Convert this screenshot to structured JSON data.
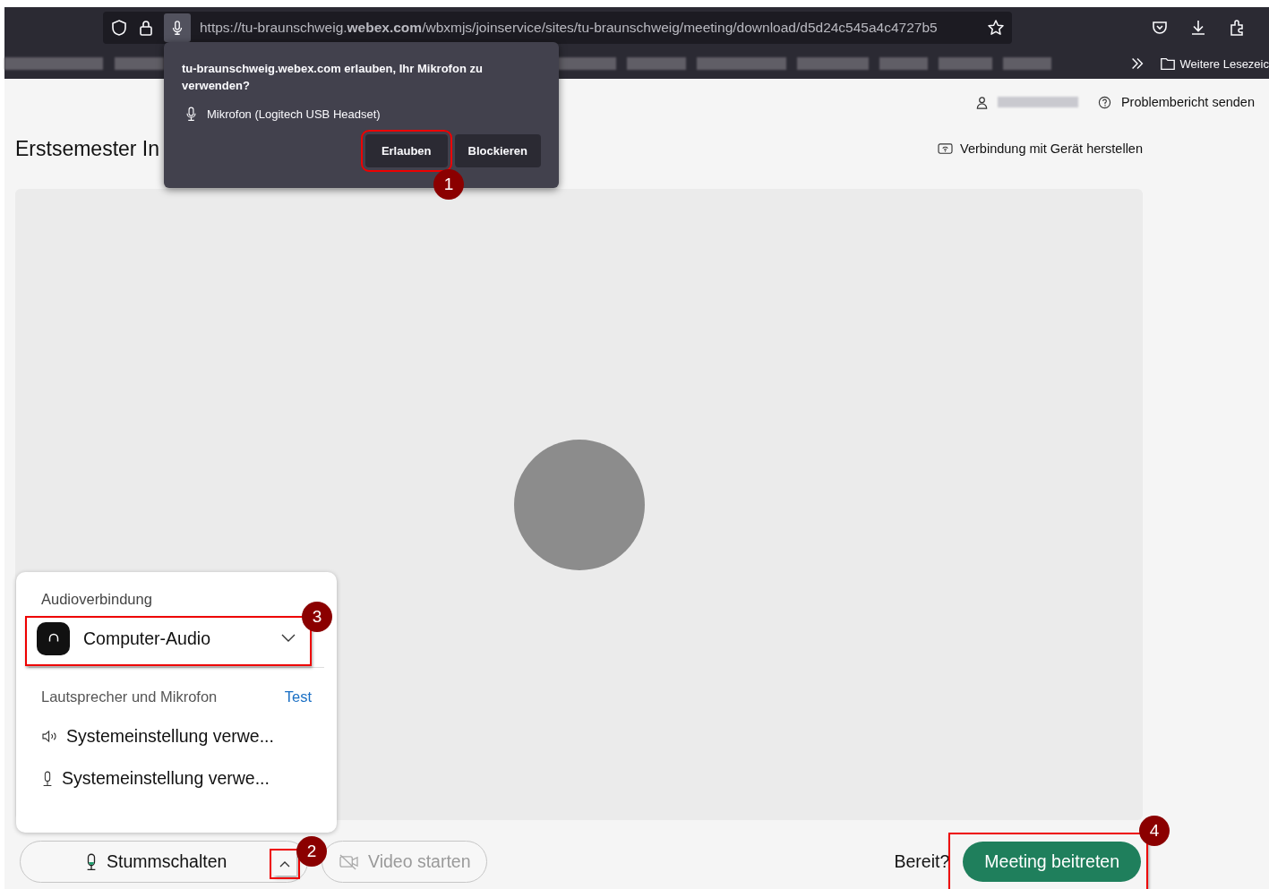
{
  "browser": {
    "url": "https://tu-braunschweig.**webex.com**/wbxmjs/joinservice/sites/tu-braunschweig/meeting/download/d5d24c545a4c4727b5",
    "bookmarks_folder": "Weitere Lesezeic"
  },
  "permission_popup": {
    "message": "tu-braunschweig.webex.com erlauben, Ihr Mikrofon zu verwenden?",
    "device": "Mikrofon (Logitech USB Headset)",
    "buttons": [
      {
        "label": "Erlauben",
        "kind": "allow"
      },
      {
        "label": "Blockieren",
        "kind": "block"
      }
    ]
  },
  "header": {
    "report": "Problembericht senden",
    "device_link": "Verbindung mit Gerät herstellen"
  },
  "meeting": {
    "title": "Erstsemester In"
  },
  "audio_panel": {
    "heading": "Audioverbindung",
    "connection": "Computer-Audio",
    "devices_heading": "Lautsprecher und Mikrofon",
    "test_link": "Test",
    "devices": [
      {
        "kind": "speaker",
        "label": "Systemeinstellung verwe..."
      },
      {
        "kind": "microphone",
        "label": "Systemeinstellung verwe..."
      }
    ]
  },
  "controls": {
    "mute": "Stummschalten",
    "video": {
      "label": "Video starten",
      "disabled": true
    },
    "ready": "Bereit?",
    "join": "Meeting beitreten"
  },
  "annotations": [
    {
      "number": "1"
    },
    {
      "number": "2"
    },
    {
      "number": "3"
    },
    {
      "number": "4"
    }
  ]
}
